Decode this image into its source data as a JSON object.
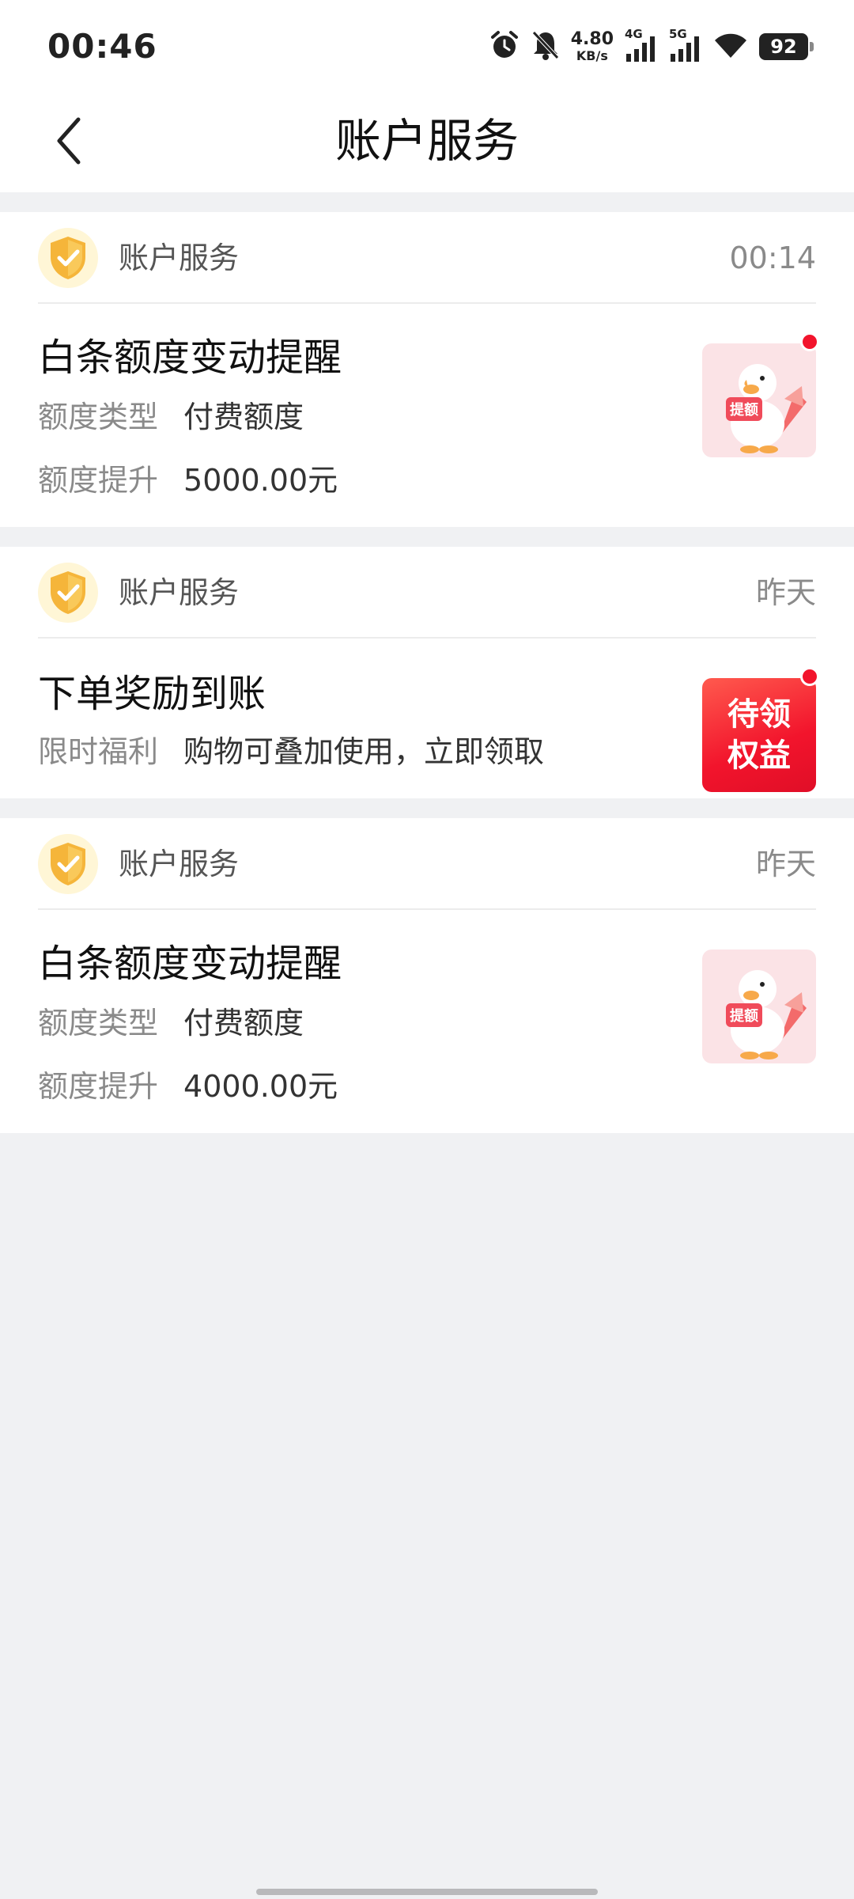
{
  "status_bar": {
    "time": "00:46",
    "net_speed_value": "4.80",
    "net_speed_unit": "KB/s",
    "sig1_label": "4G",
    "sig2_label": "5G",
    "battery": "92"
  },
  "nav": {
    "title": "账户服务"
  },
  "messages": [
    {
      "sender": "账户服务",
      "time": "00:14",
      "title": "白条额度变动提醒",
      "rows": [
        {
          "key": "额度类型",
          "value": "付费额度"
        },
        {
          "key": "额度提升",
          "value": "5000.00元"
        }
      ],
      "thumb": "duck-thumbnail",
      "unread": true
    },
    {
      "sender": "账户服务",
      "time": "昨天",
      "title": "下单奖励到账",
      "rows": [
        {
          "key": "限时福利",
          "value": "购物可叠加使用，立即领取"
        }
      ],
      "thumb_text_1": "待领",
      "thumb_text_2": "权益",
      "unread": true
    },
    {
      "sender": "账户服务",
      "time": "昨天",
      "title": "白条额度变动提醒",
      "rows": [
        {
          "key": "额度类型",
          "value": "付费额度"
        },
        {
          "key": "额度提升",
          "value": "4000.00元"
        }
      ],
      "thumb": "duck-thumbnail",
      "unread": false
    }
  ],
  "colors": {
    "accent_red": "#f2142c",
    "background": "#f0f1f3",
    "shield_gold": "#f5b53a"
  }
}
